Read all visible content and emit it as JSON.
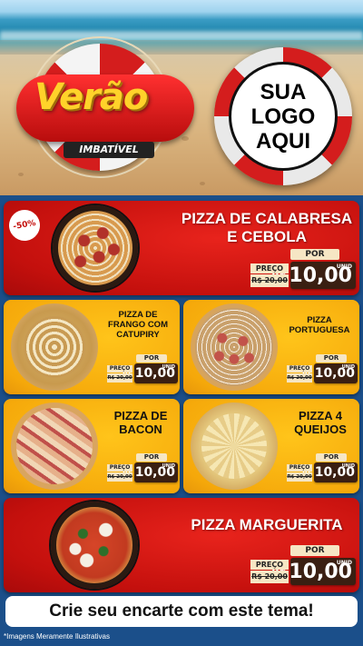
{
  "header": {
    "brand_title": "Verão",
    "brand_subtitle": "IMBATÍVEL",
    "logo_lines": [
      "SUA",
      "LOGO",
      "AQUI"
    ]
  },
  "products": [
    {
      "name_lines": [
        "PIZZA DE CALABRESA",
        "E CEBOLA"
      ],
      "discount": "-50%",
      "preco_label": "PREÇO",
      "old_price": "R$ 20,00",
      "por_label": "POR",
      "currency": "R$",
      "price": "10,00",
      "unit": "UNID"
    },
    {
      "name_lines": [
        "PIZZA DE",
        "FRANGO COM",
        "CATUPIRY"
      ],
      "preco_label": "PREÇO",
      "old_price": "R$ 20,00",
      "por_label": "POR",
      "currency": "R$",
      "price": "10,00",
      "unit": "UNID"
    },
    {
      "name_lines": [
        "PIZZA",
        "PORTUGUESA"
      ],
      "preco_label": "PREÇO",
      "old_price": "R$ 20,00",
      "por_label": "POR",
      "currency": "R$",
      "price": "10,00",
      "unit": "UNID"
    },
    {
      "name_lines": [
        "PIZZA DE",
        "BACON"
      ],
      "preco_label": "PREÇO",
      "old_price": "R$ 20,00",
      "por_label": "POR",
      "currency": "R$",
      "price": "10,00",
      "unit": "UNID"
    },
    {
      "name_lines": [
        "PIZZA 4",
        "QUEIJOS"
      ],
      "preco_label": "PREÇO",
      "old_price": "R$ 20,00",
      "por_label": "POR",
      "currency": "R$",
      "price": "10,00",
      "unit": "UNID"
    },
    {
      "name_lines": [
        "PIZZA MARGUERITA"
      ],
      "preco_label": "PREÇO",
      "old_price": "R$ 20,00",
      "por_label": "POR",
      "currency": "R$",
      "price": "10,00",
      "unit": "UNID"
    }
  ],
  "cta": "Crie seu encarte com este tema!",
  "footnote": "*Imagens Meramente Ilustrativas",
  "colors": {
    "red_panel": "#c4100d",
    "yellow_panel": "#f5a80a",
    "price_box": "#3a1f12",
    "background": "#1b4f8a"
  }
}
